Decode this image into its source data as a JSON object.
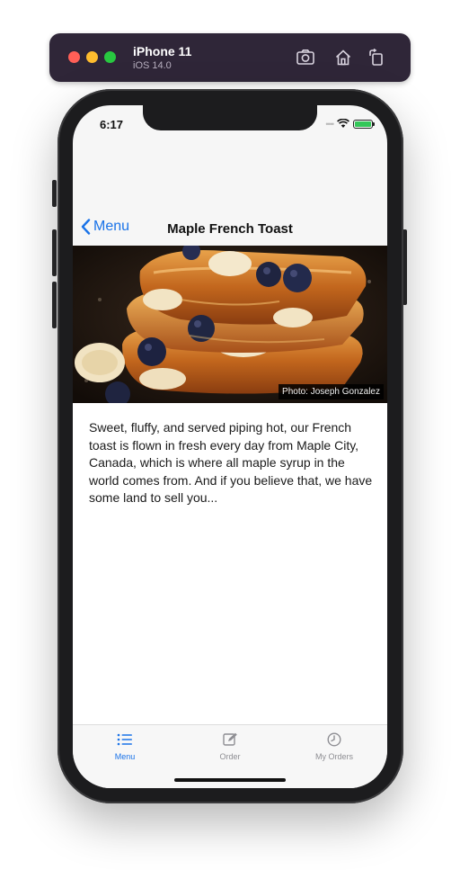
{
  "simulator": {
    "device_name": "iPhone 11",
    "os_version": "iOS 14.0"
  },
  "status_bar": {
    "time": "6:17",
    "signal": "••••"
  },
  "nav": {
    "back_label": "Menu",
    "title": "Maple French Toast"
  },
  "hero": {
    "photo_credit": "Photo: Joseph Gonzalez"
  },
  "item": {
    "description": "Sweet, fluffy, and served piping hot, our French toast is flown in fresh every day from Maple City, Canada, which is where all maple syrup in the world comes from. And if you believe that, we have some land to sell you..."
  },
  "tabs": [
    {
      "label": "Menu",
      "icon": "list-icon",
      "active": true
    },
    {
      "label": "Order",
      "icon": "edit-icon",
      "active": false
    },
    {
      "label": "My Orders",
      "icon": "clock-icon",
      "active": false
    }
  ],
  "colors": {
    "accent": "#1a73e8",
    "battery": "#34c759",
    "simulator_bar": "#2f2638"
  }
}
